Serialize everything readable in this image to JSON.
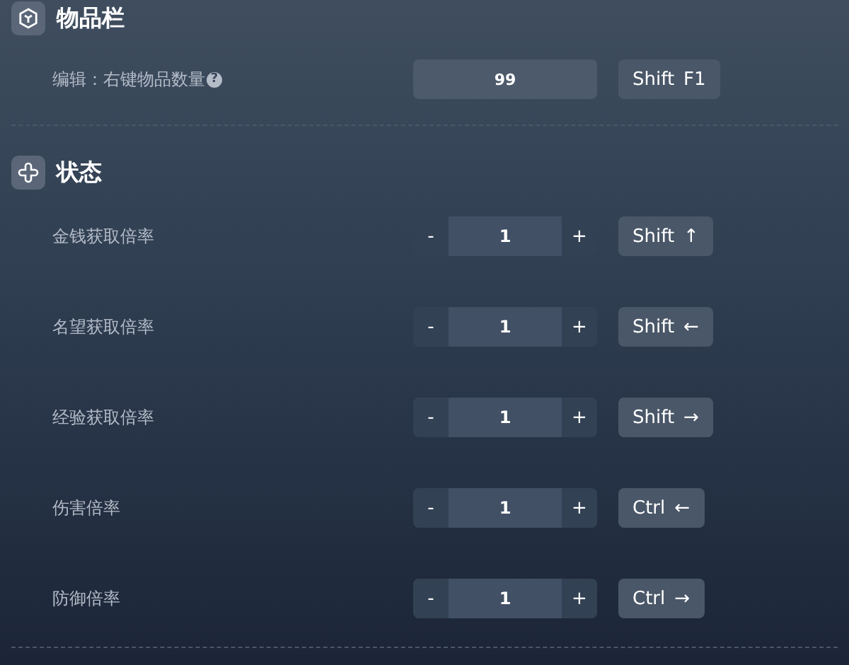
{
  "sections": [
    {
      "title": "物品栏",
      "kind": "inventory",
      "rows": [
        {
          "kind": "input",
          "label": "编辑：右键物品数量",
          "help": "?",
          "value": "99",
          "keys": [
            "Shift",
            "F1"
          ]
        }
      ]
    },
    {
      "title": "状态",
      "kind": "status",
      "rows": [
        {
          "kind": "stepper",
          "label": "金钱获取倍率",
          "minus": "-",
          "value": "1",
          "plus": "+",
          "keys": [
            "Shift",
            "↑"
          ]
        },
        {
          "kind": "stepper",
          "label": "名望获取倍率",
          "minus": "-",
          "value": "1",
          "plus": "+",
          "keys": [
            "Shift",
            "←"
          ]
        },
        {
          "kind": "stepper",
          "label": "经验获取倍率",
          "minus": "-",
          "value": "1",
          "plus": "+",
          "keys": [
            "Shift",
            "→"
          ]
        },
        {
          "kind": "stepper",
          "label": "伤害倍率",
          "minus": "-",
          "value": "1",
          "plus": "+",
          "keys": [
            "Ctrl",
            "←"
          ]
        },
        {
          "kind": "stepper",
          "label": "防御倍率",
          "minus": "-",
          "value": "1",
          "plus": "+",
          "keys": [
            "Ctrl",
            "→"
          ]
        }
      ]
    }
  ]
}
